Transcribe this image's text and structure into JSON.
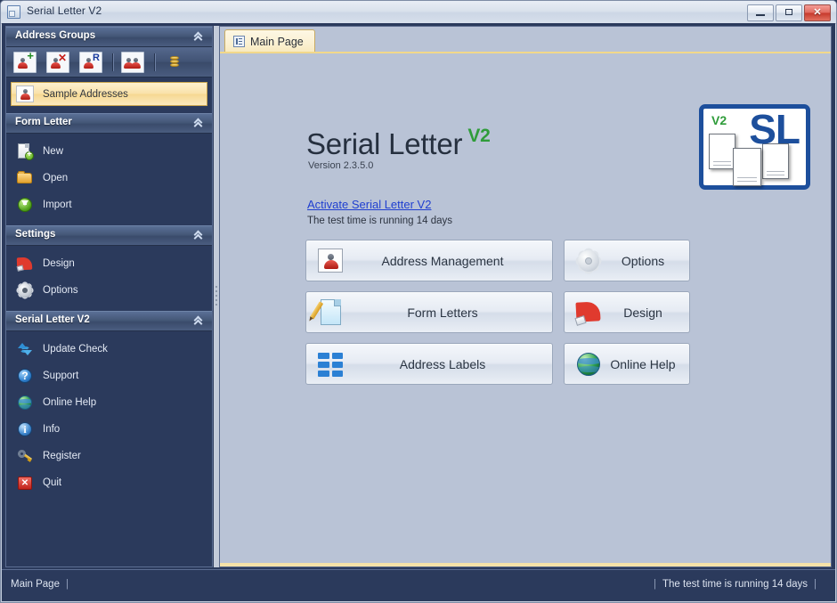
{
  "window": {
    "title": "Serial Letter V2",
    "title_icon": "app-icon",
    "controls": {
      "minimize": "minimize-button",
      "maximize": "maximize-button",
      "close": "close-button",
      "close_glyph": "✕"
    }
  },
  "sidebar": {
    "sections": [
      {
        "title": "Address Groups",
        "collapse_icon": "chevron-up-icon",
        "toolbar": [
          {
            "name": "add-address-group-button",
            "icon": "person-plus-icon",
            "badge": "+"
          },
          {
            "name": "delete-address-group-button",
            "icon": "person-delete-icon",
            "badge": "✕"
          },
          {
            "name": "rename-address-group-button",
            "icon": "person-rename-icon",
            "badge": "R"
          },
          {
            "name": "manage-groups-button",
            "icon": "two-persons-icon",
            "badge": ""
          },
          {
            "name": "database-button",
            "icon": "database-icon",
            "badge": ""
          }
        ],
        "items": [
          {
            "label": "Sample Addresses",
            "icon": "address-group-icon",
            "selected": true
          }
        ]
      },
      {
        "title": "Form Letter",
        "collapse_icon": "chevron-up-icon",
        "items": [
          {
            "label": "New",
            "icon": "new-document-icon"
          },
          {
            "label": "Open",
            "icon": "open-folder-icon"
          },
          {
            "label": "Import",
            "icon": "import-icon"
          }
        ]
      },
      {
        "title": "Settings",
        "collapse_icon": "chevron-up-icon",
        "items": [
          {
            "label": "Design",
            "icon": "color-fan-icon"
          },
          {
            "label": "Options",
            "icon": "gear-icon"
          }
        ]
      },
      {
        "title": "Serial Letter V2",
        "collapse_icon": "chevron-up-icon",
        "items": [
          {
            "label": "Update Check",
            "icon": "refresh-icon"
          },
          {
            "label": "Support",
            "icon": "question-ball-icon"
          },
          {
            "label": "Online Help",
            "icon": "globe-icon"
          },
          {
            "label": "Info",
            "icon": "info-ball-icon"
          },
          {
            "label": "Register",
            "icon": "key-icon"
          },
          {
            "label": "Quit",
            "icon": "quit-icon"
          }
        ]
      }
    ]
  },
  "tabs": [
    {
      "label": "Main Page",
      "icon": "page-icon",
      "active": true
    }
  ],
  "main": {
    "hero": {
      "title": "Serial Letter",
      "title_suffix": "V2",
      "version": "Version 2.3.5.0",
      "activate_link": "Activate Serial Letter V2",
      "trial_note": "The test time is running 14 days"
    },
    "logo": {
      "badge": "V2",
      "mark": "SL"
    },
    "buttons_left": [
      {
        "label": "Address Management",
        "icon": "address-card-icon"
      },
      {
        "label": "Form Letters",
        "icon": "letter-pencil-icon"
      },
      {
        "label": "Address Labels",
        "icon": "labels-grid-icon"
      }
    ],
    "buttons_right": [
      {
        "label": "Options",
        "icon": "gear-icon"
      },
      {
        "label": "Design",
        "icon": "color-fan-icon"
      },
      {
        "label": "Online Help",
        "icon": "globe-icon"
      }
    ]
  },
  "statusbar": {
    "left": "Main Page",
    "right": "The test time is running 14 days",
    "separator": "|"
  },
  "colors": {
    "accent_green": "#2f9c3a",
    "link_blue": "#1f3fd0",
    "logo_blue": "#1d4f9c",
    "sidebar_bg": "#2b3a5c",
    "content_bg": "#b9c3d6",
    "tab_yellow": "#f5e2a8"
  }
}
